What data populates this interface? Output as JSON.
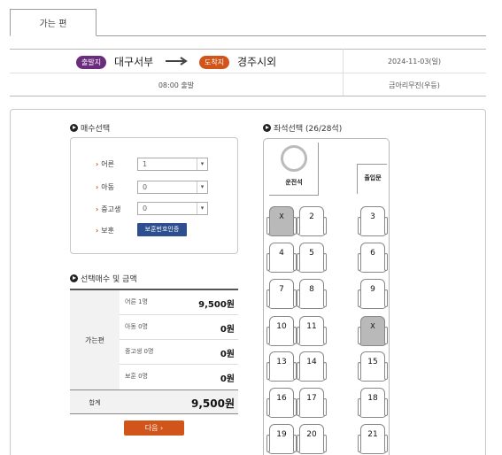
{
  "tab": {
    "label": "가는 편"
  },
  "route": {
    "departure_badge": "출발지",
    "departure_city": "대구서부",
    "arrival_badge": "도착지",
    "arrival_city": "경주시외",
    "date": "2024-11-03(일)",
    "time": "08:00 출발",
    "company": "금아리무진(우등)"
  },
  "count_section": {
    "title": "매수선택",
    "rows": [
      {
        "label": "어른",
        "value": "1"
      },
      {
        "label": "아동",
        "value": "0"
      },
      {
        "label": "중고생",
        "value": "0"
      }
    ],
    "discount_label": "보훈",
    "discount_button": "보훈번호인증"
  },
  "fare_section": {
    "title": "선택매수 및 금액",
    "trip_label": "가는편",
    "rows": [
      {
        "label": "어른 1명",
        "value": "9,500원"
      },
      {
        "label": "아동 0명",
        "value": "0원"
      },
      {
        "label": "중고생 0명",
        "value": "0원"
      },
      {
        "label": "보훈 0명",
        "value": "0원"
      }
    ],
    "total_label": "합계",
    "total_value": "9,500원"
  },
  "next_button": "다음 ›",
  "seat_section": {
    "title": "좌석선택 (26/28석)",
    "driver_label": "운전석",
    "door_label": "출입문",
    "seats": [
      {
        "label": "X",
        "taken": true
      },
      {
        "label": "2",
        "taken": false
      },
      {
        "label": "3",
        "taken": false
      },
      {
        "label": "4",
        "taken": false
      },
      {
        "label": "5",
        "taken": false
      },
      {
        "label": "6",
        "taken": false
      },
      {
        "label": "7",
        "taken": false
      },
      {
        "label": "8",
        "taken": false
      },
      {
        "label": "9",
        "taken": false
      },
      {
        "label": "10",
        "taken": false
      },
      {
        "label": "11",
        "taken": false
      },
      {
        "label": "X",
        "taken": true
      },
      {
        "label": "13",
        "taken": false
      },
      {
        "label": "14",
        "taken": false
      },
      {
        "label": "15",
        "taken": false
      },
      {
        "label": "16",
        "taken": false
      },
      {
        "label": "17",
        "taken": false
      },
      {
        "label": "18",
        "taken": false
      },
      {
        "label": "19",
        "taken": false
      },
      {
        "label": "20",
        "taken": false
      },
      {
        "label": "21",
        "taken": false
      }
    ]
  }
}
